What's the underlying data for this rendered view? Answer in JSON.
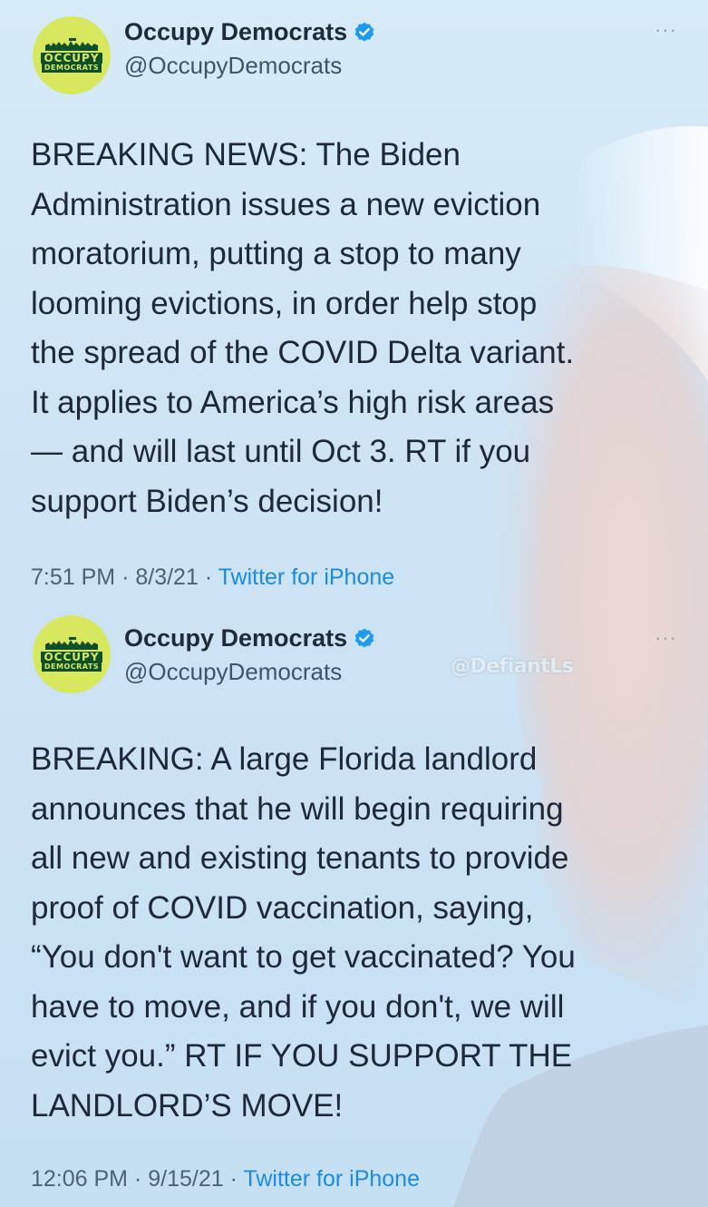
{
  "tweets": [
    {
      "author": {
        "name": "Occupy Democrats",
        "handle": "@OccupyDemocrats",
        "avatar_text_1": "OCCUPY",
        "avatar_text_2": "DEMOCRATS",
        "verified_icon": "verified-badge-icon"
      },
      "more_label": "···",
      "text": "BREAKING NEWS: The Biden\nAdministration issues a new eviction\nmoratorium, putting a stop to many\nlooming evictions, in order help stop\nthe spread of the COVID Delta variant.\nIt applies to America’s high risk areas\n— and will last until Oct 3. RT if you\nsupport Biden’s decision!",
      "time": "7:51 PM",
      "date": "8/3/21",
      "separator": "·",
      "source": "Twitter for iPhone"
    },
    {
      "author": {
        "name": "Occupy Democrats",
        "handle": "@OccupyDemocrats",
        "avatar_text_1": "OCCUPY",
        "avatar_text_2": "DEMOCRATS",
        "verified_icon": "verified-badge-icon"
      },
      "more_label": "···",
      "text": "BREAKING: A large Florida landlord\nannounces that he will begin requiring\nall new and existing tenants to provide\nproof of COVID vaccination, saying,\n“You don't want to get vaccinated? You\nhave to move, and if you don't, we will\nevict you.” RT IF YOU SUPPORT THE\nLANDLORD’S MOVE!",
      "time": "12:06 PM",
      "date": "9/15/21",
      "separator": "·",
      "source": "Twitter for iPhone"
    }
  ],
  "watermark": "@DefiantLs",
  "colors": {
    "background": "#cfe6f6",
    "link": "#1c8ae0",
    "verified": "#1d9bf0",
    "avatar": "#d7e85f"
  }
}
